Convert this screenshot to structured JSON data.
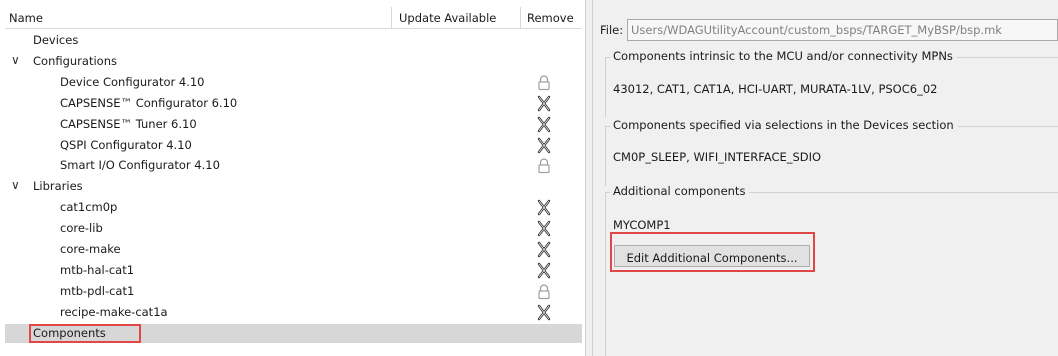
{
  "tree": {
    "columns": {
      "name": "Name",
      "update": "Update Available",
      "remove": "Remove"
    },
    "items": [
      {
        "label": "Devices",
        "level": 0,
        "expandable": false,
        "icon": ""
      },
      {
        "label": "Configurations",
        "level": 0,
        "expandable": true,
        "expanded": true,
        "icon": ""
      },
      {
        "label": "Device Configurator 4.10",
        "level": 1,
        "icon": "lock-icon"
      },
      {
        "label": "CAPSENSE™ Configurator 6.10",
        "level": 1,
        "icon": "remove-x-icon"
      },
      {
        "label": "CAPSENSE™ Tuner 6.10",
        "level": 1,
        "icon": "remove-x-icon"
      },
      {
        "label": "QSPI Configurator 4.10",
        "level": 1,
        "icon": "remove-x-icon"
      },
      {
        "label": "Smart I/O Configurator 4.10",
        "level": 1,
        "icon": "lock-icon"
      },
      {
        "label": "Libraries",
        "level": 0,
        "expandable": true,
        "expanded": true,
        "icon": ""
      },
      {
        "label": "cat1cm0p",
        "level": 1,
        "icon": "remove-x-icon"
      },
      {
        "label": "core-lib",
        "level": 1,
        "icon": "remove-x-icon"
      },
      {
        "label": "core-make",
        "level": 1,
        "icon": "remove-x-icon"
      },
      {
        "label": "mtb-hal-cat1",
        "level": 1,
        "icon": "remove-x-icon"
      },
      {
        "label": "mtb-pdl-cat1",
        "level": 1,
        "icon": "lock-icon"
      },
      {
        "label": "recipe-make-cat1a",
        "level": 1,
        "icon": "remove-x-icon"
      },
      {
        "label": "Components",
        "level": 0,
        "expandable": false,
        "selected": true,
        "icon": ""
      }
    ]
  },
  "details": {
    "file_label": "File:",
    "file_path": "Users/WDAGUtilityAccount/custom_bsps/TARGET_MyBSP/bsp.mk",
    "groups": [
      {
        "title": "Components intrinsic to the MCU and/or connectivity MPNs",
        "value": "43012, CAT1, CAT1A, HCI-UART, MURATA-1LV, PSOC6_02"
      },
      {
        "title": "Components specified via selections in the Devices section",
        "value": "CM0P_SLEEP, WIFI_INTERFACE_SDIO"
      },
      {
        "title": "Additional components",
        "value": "MYCOMP1"
      }
    ],
    "edit_button": "Edit Additional Components..."
  },
  "colors": {
    "highlight": "#e04848",
    "selected_row": "#d7d7d7",
    "panel_bg": "#f0f0f0"
  }
}
